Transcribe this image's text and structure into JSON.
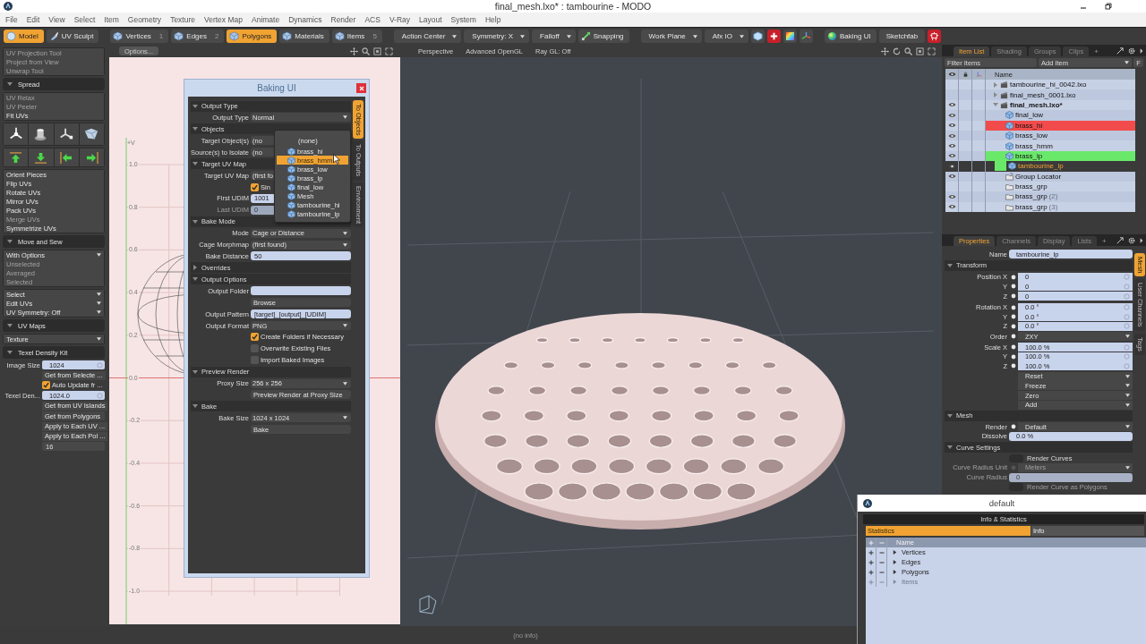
{
  "window": {
    "title": "final_mesh.lxo* : tambourine - MODO"
  },
  "menu": [
    "File",
    "Edit",
    "View",
    "Select",
    "Item",
    "Geometry",
    "Texture",
    "Vertex Map",
    "Animate",
    "Dynamics",
    "Render",
    "ACS",
    "V-Ray",
    "Layout",
    "System",
    "Help"
  ],
  "toolbar": {
    "modes": [
      {
        "label": "Model",
        "selected": true
      },
      {
        "label": "UV Sculpt",
        "selected": false
      }
    ],
    "selection_modes": [
      {
        "label": "Vertices",
        "shortcut": "1",
        "selected": false
      },
      {
        "label": "Edges",
        "shortcut": "2",
        "selected": false
      },
      {
        "label": "Polygons",
        "selected": true
      },
      {
        "label": "Materials",
        "selected": false
      },
      {
        "label": "Items",
        "shortcut": "5",
        "selected": false
      }
    ],
    "controls": [
      {
        "kind": "dropdown",
        "label": "Action Center"
      },
      {
        "kind": "dropdown",
        "label": "Symmetry: X"
      },
      {
        "kind": "dropdown",
        "label": "Falloff"
      },
      {
        "kind": "button",
        "label": "Snapping"
      },
      {
        "kind": "dropdown",
        "label": "Work Plane"
      },
      {
        "kind": "dropdown",
        "label": "Afx IO"
      }
    ],
    "plugins": [
      {
        "kind": "icon_button",
        "label": "Baking UI"
      },
      {
        "kind": "text_button",
        "label": "Sketchfab"
      }
    ]
  },
  "uv_tools": [
    {
      "kind": "list",
      "items": [
        {
          "kind": "button",
          "label": "UV Projection Tool",
          "disabled": true
        },
        {
          "kind": "button",
          "label": "Project from View",
          "disabled": true
        },
        {
          "kind": "button",
          "label": "Unwrap Tool",
          "disabled": true
        }
      ]
    },
    {
      "kind": "list",
      "items": [
        {
          "kind": "header",
          "label": "Spread",
          "expanded": true
        }
      ]
    },
    {
      "kind": "list",
      "items": [
        {
          "kind": "button",
          "label": "UV Relax",
          "disabled": true
        },
        {
          "kind": "button",
          "label": "UV Peeler",
          "disabled": true
        },
        {
          "kind": "button",
          "label": "Fit UVs",
          "disabled": false
        }
      ]
    },
    {
      "kind": "list",
      "items": [
        {
          "kind": "transform_icons"
        }
      ]
    },
    {
      "kind": "list",
      "items": [
        {
          "kind": "arrow_icons"
        }
      ]
    },
    {
      "kind": "list",
      "items": [
        {
          "kind": "button",
          "label": "Orient Pieces",
          "disabled": false
        },
        {
          "kind": "button",
          "label": "Flip UVs",
          "disabled": false
        },
        {
          "kind": "button",
          "label": "Rotate UVs",
          "disabled": false
        },
        {
          "kind": "button",
          "label": "Mirror UVs",
          "disabled": false
        },
        {
          "kind": "button",
          "label": "Pack UVs",
          "disabled": false
        },
        {
          "kind": "button",
          "label": "Merge UVs",
          "disabled": true
        },
        {
          "kind": "button",
          "label": "Symmetrize UVs",
          "disabled": false
        }
      ]
    },
    {
      "kind": "list",
      "items": [
        {
          "kind": "header",
          "label": "Move and Sew",
          "expanded": true
        }
      ]
    },
    {
      "kind": "list",
      "items": [
        {
          "kind": "dropdown",
          "label": "With Options",
          "disabled": false
        },
        {
          "kind": "button",
          "label": "Unselected",
          "disabled": true
        },
        {
          "kind": "button",
          "label": "Averaged",
          "disabled": true
        },
        {
          "kind": "button",
          "label": "Selected",
          "disabled": true
        }
      ]
    },
    {
      "kind": "list",
      "items": [
        {
          "kind": "dropdown",
          "label": "Select",
          "disabled": false
        },
        {
          "kind": "dropdown",
          "label": "Edit UVs",
          "disabled": false
        },
        {
          "kind": "dropdown",
          "label": "UV Symmetry: Off",
          "disabled": false
        }
      ]
    },
    {
      "kind": "list",
      "items": [
        {
          "kind": "header",
          "label": "UV Maps",
          "expanded": true
        }
      ]
    },
    {
      "kind": "list",
      "items": [
        {
          "kind": "dropdown",
          "label": "Texture",
          "disabled": false
        }
      ]
    },
    {
      "kind": "list",
      "items": [
        {
          "kind": "header",
          "label": "Texel Density Kit",
          "expanded": true
        }
      ]
    },
    {
      "kind": "form",
      "items": [
        {
          "kind": "field",
          "label": "Image Size",
          "value": "1024"
        },
        {
          "kind": "button",
          "label": "Get from Selecte ...",
          "disabled": false
        },
        {
          "kind": "checkbox",
          "label": "Auto Update fr ...",
          "checked": true
        },
        {
          "kind": "field",
          "label": "Texel Den...",
          "value": "1024.0"
        },
        {
          "kind": "button",
          "label": "Get from UV Islands",
          "disabled": false
        },
        {
          "kind": "button",
          "label": "Get from Polygons",
          "disabled": false
        },
        {
          "kind": "button",
          "label": "Apply to Each UV ...",
          "disabled": false
        },
        {
          "kind": "button",
          "label": "Apply to Each Pol ...",
          "disabled": false
        },
        {
          "kind": "field",
          "value": "16"
        }
      ]
    }
  ],
  "uv_editor": {
    "options_button": "Options...",
    "axis_label": "+V",
    "v_ticks": [
      "1.0",
      "0.8",
      "0.6",
      "0.4",
      "0.2",
      "0.0",
      "-0.2",
      "-0.4",
      "-0.6",
      "-0.8",
      "-1.0"
    ]
  },
  "viewport": {
    "menus": [
      "Perspective",
      "Advanced OpenGL",
      "Ray GL: Off"
    ]
  },
  "item_list": {
    "tabs": [
      {
        "label": "Item List",
        "selected": true
      },
      {
        "label": "Shading",
        "selected": false
      },
      {
        "label": "Groups",
        "selected": false
      },
      {
        "label": "Clips",
        "selected": false
      }
    ],
    "add_tab": "+",
    "filter": {
      "placeholder": "Filter Items"
    },
    "add_item": "Add Item",
    "filter_button": "F",
    "name_column": "Name",
    "items": [
      {
        "name": "tambourine_hi_0042.lxo",
        "kind": "scene",
        "active": false,
        "expanded": false,
        "visible": false,
        "selected": false
      },
      {
        "name": "final_mesh_0001.lxo",
        "kind": "scene",
        "active": false,
        "expanded": false,
        "visible": false,
        "selected": false
      },
      {
        "name": "final_mesh.lxo*",
        "kind": "scene",
        "active": true,
        "expanded": true,
        "visible": true,
        "selected": false,
        "children": [
          {
            "name": "final_low",
            "kind": "mesh",
            "visible": true,
            "selected": false
          },
          {
            "name": "brass_hi",
            "kind": "mesh",
            "visible": true,
            "selected": false,
            "color": "#f24b4b"
          },
          {
            "name": "brass_low",
            "kind": "mesh",
            "visible": true,
            "selected": false
          },
          {
            "name": "brass_hmm",
            "kind": "mesh",
            "visible": true,
            "selected": false
          },
          {
            "name": "brass_lp",
            "kind": "mesh",
            "visible": true,
            "selected": false,
            "color": "#6ae86a"
          },
          {
            "name": "tambourine_lp",
            "kind": "mesh",
            "visible": true,
            "selected": true,
            "color": "#6ae86a"
          },
          {
            "name": "Group Locator",
            "kind": "locator",
            "visible": true,
            "selected": false
          },
          {
            "name": "brass_grp",
            "kind": "group",
            "visible": false,
            "selected": false
          },
          {
            "name": "brass_grp",
            "suffix": "(2)",
            "kind": "group",
            "visible": true,
            "selected": false
          },
          {
            "name": "brass_grp",
            "suffix": "(3)",
            "kind": "group",
            "visible": true,
            "selected": false
          }
        ]
      }
    ]
  },
  "properties": {
    "tabs": [
      {
        "label": "Properties",
        "selected": true
      },
      {
        "label": "Channels",
        "selected": false
      },
      {
        "label": "Display",
        "selected": false
      },
      {
        "label": "Lists",
        "selected": false
      }
    ],
    "add_tab": "+",
    "side_tabs": [
      {
        "label": "Mesh",
        "selected": true
      },
      {
        "label": "User Channels",
        "selected": false
      },
      {
        "label": "Tags",
        "selected": false
      }
    ],
    "name": {
      "label": "Name",
      "value": "tambourine_lp"
    },
    "sections": [
      {
        "title": "Transform",
        "expanded": true,
        "rows": [
          {
            "kind": "vector",
            "components": [
              {
                "label": "Position X",
                "value": "0"
              },
              {
                "label": "Y",
                "value": "0"
              },
              {
                "label": "Z",
                "value": "0"
              }
            ]
          },
          {
            "kind": "vector",
            "components": [
              {
                "label": "Rotation X",
                "value": "0.0 °"
              },
              {
                "label": "Y",
                "value": "0.0 °"
              },
              {
                "label": "Z",
                "value": "0.0 °"
              }
            ]
          },
          {
            "kind": "dropdown",
            "label": "Order",
            "value": "ZXY",
            "disabled": false
          },
          {
            "kind": "vector",
            "components": [
              {
                "label": "Scale X",
                "value": "100.0 %"
              },
              {
                "label": "Y",
                "value": "100.0 %"
              },
              {
                "label": "Z",
                "value": "100.0 %"
              }
            ]
          },
          {
            "kind": "menu",
            "value": "Reset"
          },
          {
            "kind": "menu",
            "value": "Freeze"
          },
          {
            "kind": "menu",
            "value": "Zero"
          },
          {
            "kind": "menu",
            "value": "Add"
          }
        ]
      },
      {
        "title": "Mesh",
        "expanded": true,
        "rows": [
          {
            "kind": "dropdown",
            "label": "Render",
            "value": "Default",
            "disabled": false
          },
          {
            "kind": "field",
            "label": "Dissolve",
            "value": "0.0 %",
            "disabled": false
          }
        ]
      },
      {
        "title": "Curve Settings",
        "expanded": true,
        "rows": [
          {
            "kind": "checkbox",
            "label": "Render Curves",
            "checked": false,
            "disabled": false
          },
          {
            "kind": "dropdown",
            "label": "Curve Radius Unit",
            "value": "Meters",
            "disabled": true
          },
          {
            "kind": "field",
            "label": "Curve Radius",
            "value": "0",
            "disabled": true
          },
          {
            "kind": "checkbox",
            "label": "Render Curve as Polygons",
            "checked": false,
            "disabled": true
          }
        ]
      }
    ]
  },
  "baking_ui": {
    "title": "Baking UI",
    "side_tabs": [
      {
        "label": "To Objects",
        "selected": true
      },
      {
        "label": "To Outputs",
        "selected": false
      },
      {
        "label": "Environment",
        "selected": false
      }
    ],
    "sections": [
      {
        "title": "Output Type",
        "expanded": true,
        "rows": [
          {
            "kind": "dropdown",
            "label": "Output Type",
            "value": "Normal"
          }
        ]
      },
      {
        "title": "Objects",
        "expanded": true,
        "rows": [
          {
            "kind": "dropdown",
            "label": "Target Object(s)",
            "value": "(no"
          },
          {
            "kind": "dropdown",
            "label": "Source(s) to Isolate",
            "value": "(no"
          }
        ]
      },
      {
        "title": "Target UV Map",
        "expanded": true,
        "rows": [
          {
            "kind": "dropdown",
            "label": "Target UV Map",
            "value": "(first fo"
          },
          {
            "kind": "checkbox",
            "label": "Sin",
            "checked": true
          },
          {
            "kind": "field",
            "label": "First UDIM",
            "value": "1001",
            "disabled": false
          },
          {
            "kind": "field",
            "label": "Last UDIM",
            "value": "0",
            "disabled": true
          }
        ]
      },
      {
        "title": "Bake Mode",
        "expanded": true,
        "rows": [
          {
            "kind": "dropdown",
            "label": "Mode",
            "value": "Cage or Distance"
          },
          {
            "kind": "dropdown",
            "label": "Cage Morphmap",
            "value": "(first found)"
          },
          {
            "kind": "field",
            "label": "Bake Distance",
            "value": "50",
            "disabled": false
          }
        ]
      },
      {
        "title": "Overrides",
        "expanded": false
      },
      {
        "title": "Output Options",
        "expanded": true,
        "rows": [
          {
            "kind": "field",
            "label": "Output Folder",
            "disabled": false
          },
          {
            "kind": "button",
            "label": "Browse"
          },
          {
            "kind": "field",
            "label": "Output Pattern",
            "value": "[target]_[output]_[UDIM]",
            "disabled": false
          },
          {
            "kind": "dropdown",
            "label": "Output Format",
            "value": "PNG"
          },
          {
            "kind": "checkbox",
            "label": "Create Folders if Necessary",
            "checked": true
          },
          {
            "kind": "checkbox",
            "label": "Overwrite Existing Files",
            "checked": false
          },
          {
            "kind": "checkbox",
            "label": "Import Baked Images",
            "checked": false
          }
        ]
      },
      {
        "title": "Preview Render",
        "expanded": true,
        "rows": [
          {
            "kind": "dropdown",
            "label": "Proxy Size",
            "value": "256 x 256"
          },
          {
            "kind": "button",
            "label": "Preview Render at Proxy Size"
          }
        ]
      },
      {
        "title": "Bake",
        "expanded": true,
        "rows": [
          {
            "kind": "dropdown",
            "label": "Bake Size",
            "value": "1024 x 1024"
          },
          {
            "kind": "button",
            "label": "Bake"
          }
        ]
      }
    ]
  },
  "object_menu": {
    "items": [
      {
        "label": "(none)",
        "kind": "none",
        "selected": false
      },
      {
        "label": "brass_hi",
        "kind": "mesh",
        "selected": false
      },
      {
        "label": "brass_hmm",
        "kind": "mesh",
        "selected": true
      },
      {
        "label": "brass_low",
        "kind": "mesh",
        "selected": false
      },
      {
        "label": "brass_lp",
        "kind": "mesh",
        "selected": false
      },
      {
        "label": "final_low",
        "kind": "mesh",
        "selected": false
      },
      {
        "label": "Mesh",
        "kind": "mesh",
        "selected": false
      },
      {
        "label": "tambourine_hi",
        "kind": "mesh",
        "selected": false
      },
      {
        "label": "tambourine_lp",
        "kind": "mesh",
        "selected": false
      }
    ]
  },
  "info_window": {
    "title": "default",
    "panel_title": "Info & Statistics",
    "tabs": [
      {
        "label": "Statistics",
        "selected": true
      },
      {
        "label": "Info",
        "selected": false
      }
    ],
    "name_column": "Name",
    "rows": [
      {
        "name": "Vertices",
        "disabled": false
      },
      {
        "name": "Edges",
        "disabled": false
      },
      {
        "name": "Polygons",
        "disabled": false
      },
      {
        "name": "Items",
        "disabled": true
      }
    ]
  },
  "status_bar": "(no info)"
}
